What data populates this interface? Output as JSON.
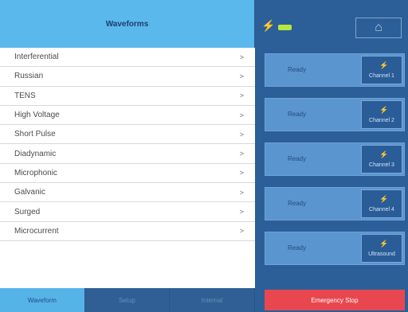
{
  "left": {
    "header": "Waveforms",
    "items": [
      "Interferential",
      "Russian",
      "TENS",
      "High Voltage",
      "Short Pulse",
      "Diadynamic",
      "Microphonic",
      "Galvanic",
      "Surged",
      "Microcurrent"
    ],
    "chevron": ">"
  },
  "bottom_nav": {
    "items": [
      "Waveform",
      "Setup",
      "Internal"
    ]
  },
  "right": {
    "plug_icon": "⚡",
    "battery_icon": "battery-icon",
    "top_button_icon": "⌂",
    "channels": [
      {
        "status": "Ready",
        "label": "Channel 1",
        "icon": "⚡"
      },
      {
        "status": "Ready",
        "label": "Channel 2",
        "icon": "⚡"
      },
      {
        "status": "Ready",
        "label": "Channel 3",
        "icon": "⚡"
      },
      {
        "status": "Ready",
        "label": "Channel 4",
        "icon": "⚡"
      },
      {
        "status": "Ready",
        "label": "Ultrasound",
        "icon": "⚡"
      }
    ],
    "emergency_stop": "Emergency Stop"
  },
  "colors": {
    "header_blue": "#5ab8ec",
    "panel_blue": "#5b95cf",
    "dark_blue": "#2c5f98",
    "emergency_red": "#e9474f",
    "battery_green": "#b8e63f"
  }
}
